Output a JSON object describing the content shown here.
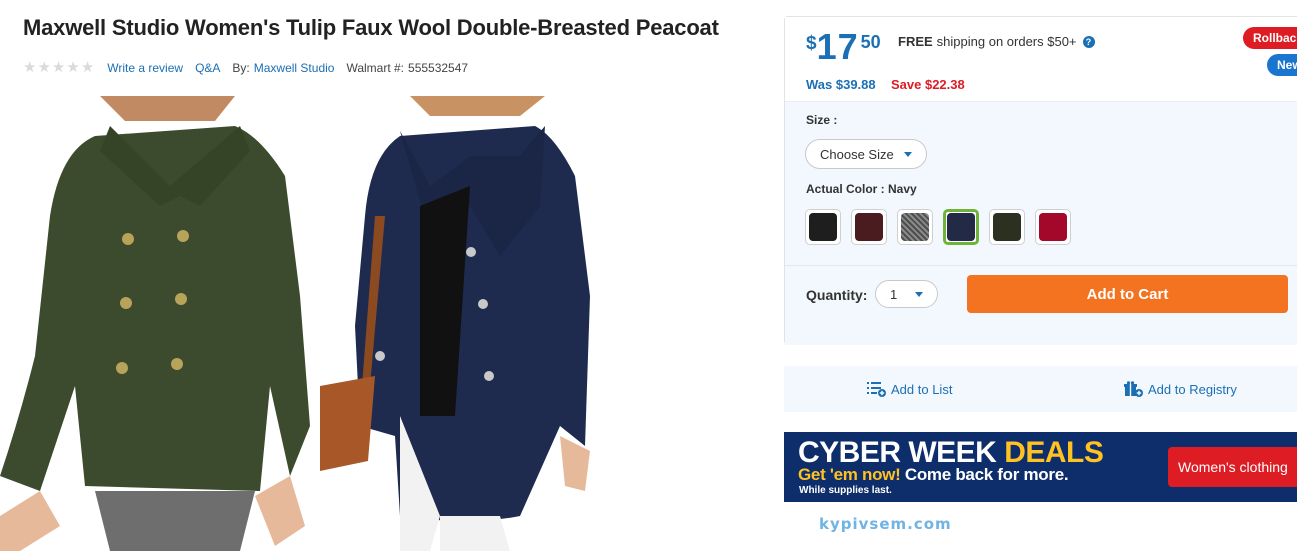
{
  "product": {
    "title": "Maxwell Studio Women's Tulip Faux Wool Double-Breasted Peacoat",
    "rating_stars": 0,
    "write_review_label": "Write a review",
    "qa_label": "Q&A",
    "by_label": "By:",
    "brand": "Maxwell Studio",
    "item_number_label": "Walmart #:",
    "item_number": "555532547"
  },
  "buybox": {
    "price_currency": "$",
    "price_dollars": "17",
    "price_cents": "50",
    "shipping_free": "FREE",
    "shipping_text": "shipping on orders $50+",
    "was_price": "Was $39.88",
    "save_text": "Save $22.38",
    "badge_rollback": "Rollback",
    "badge_new": "New",
    "size_label": "Size :",
    "size_select": "Choose Size",
    "color_label": "Actual Color : Navy",
    "swatches": [
      {
        "name": "Black",
        "color": "#1e1e1e",
        "selected": false
      },
      {
        "name": "Burgundy",
        "color": "#4a1b1f",
        "selected": false
      },
      {
        "name": "Gray Tweed",
        "color": "#6b6b6b",
        "selected": false
      },
      {
        "name": "Navy",
        "color": "#232a45",
        "selected": true
      },
      {
        "name": "Olive",
        "color": "#2b3020",
        "selected": false
      },
      {
        "name": "Red",
        "color": "#a3082a",
        "selected": false
      }
    ],
    "quantity_label": "Quantity:",
    "quantity_value": "1",
    "add_to_cart": "Add to Cart"
  },
  "actions": {
    "add_to_list": "Add to List",
    "add_to_registry": "Add to Registry"
  },
  "banner": {
    "line1_white": "CYBER WEEK ",
    "line1_accent": "DEALS",
    "line2_accent": "Get 'em now!",
    "line2_white": " Come back for more.",
    "line3": "While supplies last.",
    "cta": "Women's clothing"
  },
  "watermark": "kypivsem.com",
  "colors": {
    "link_blue": "#1b6fb4",
    "sale_red": "#de1c24",
    "cart_orange": "#f47321",
    "banner_navy": "#0e2d6b",
    "banner_yellow": "#ffc220",
    "selected_green": "#6fb33b"
  }
}
